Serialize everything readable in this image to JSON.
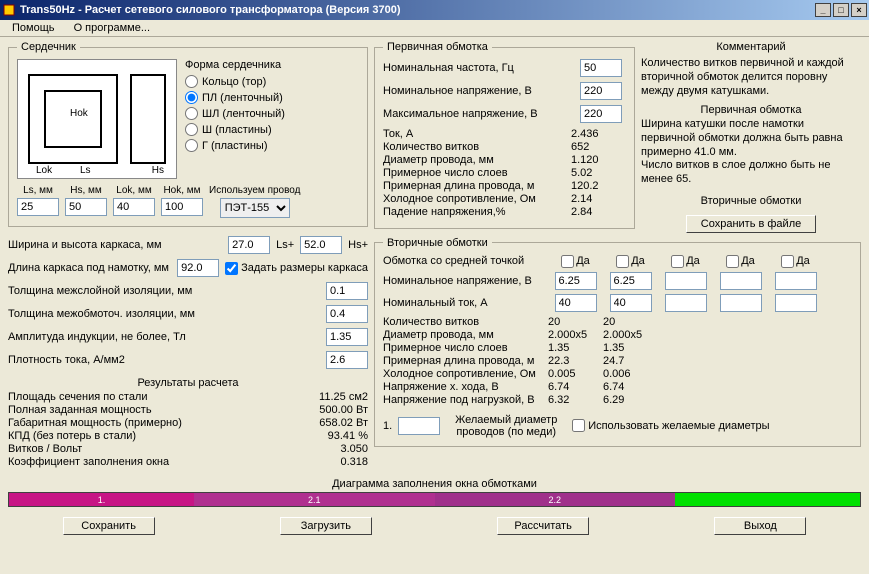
{
  "title": "Trans50Hz - Расчет сетевого силового трансформатора (Версия 3700)",
  "menu": {
    "help": "Помощь",
    "about": "О программе..."
  },
  "core": {
    "legend": "Сердечник",
    "shape_label": "Форма сердечника",
    "opts": {
      "ring": "Кольцо (тор)",
      "pl": "ПЛ (ленточный)",
      "shl": "ШЛ (ленточный)",
      "sh": "Ш (пластины)",
      "g": "Г (пластины)"
    },
    "diagram": {
      "hok": "Hok",
      "lok": "Lok",
      "ls": "Ls",
      "hs": "Hs"
    },
    "dims": {
      "ls_l": "Ls, мм",
      "hs_l": "Hs, мм",
      "lok_l": "Lok, мм",
      "hok_l": "Hok, мм",
      "ls": "25",
      "hs": "50",
      "lok": "40",
      "hok": "100"
    },
    "wire": {
      "label": "Используем провод",
      "sel": "ПЭТ-155"
    },
    "frame_wh": "Ширина и высота каркаса, мм",
    "frame_w": "27.0",
    "frame_ls": "Ls+",
    "frame_h": "52.0",
    "frame_hs": "Hs+",
    "frame_len": "Длина каркаса под намотку, мм",
    "frame_len_v": "92.0",
    "frame_chk": "Задать размеры каркаса",
    "interlayer": "Толщина межслойной изоляции, мм",
    "interlayer_v": "0.1",
    "interwind": "Толщина межобмоточ. изоляции, мм",
    "interwind_v": "0.4",
    "induction": "Амплитуда индукции, не более, Тл",
    "induction_v": "1.35",
    "density": "Плотность тока, А/мм2",
    "density_v": "2.6"
  },
  "results": {
    "title": "Результаты расчета",
    "items": [
      [
        "Площадь сечения по стали",
        "11.25 см2"
      ],
      [
        "Полная заданная мощность",
        "500.00 Вт"
      ],
      [
        "Габаритная мощность (примерно)",
        "658.02 Вт"
      ],
      [
        "КПД (без потерь в стали)",
        "93.41 %"
      ],
      [
        "Витков / Вольт",
        "3.050"
      ],
      [
        "Коэффициент заполнения окна",
        "0.318"
      ]
    ]
  },
  "primary": {
    "legend": "Первичная обмотка",
    "rows": [
      [
        "Номинальная частота, Гц",
        "50"
      ],
      [
        "Номинальное напряжение, В",
        "220"
      ],
      [
        "Максимальное напряжение, В",
        "220"
      ]
    ],
    "out": [
      [
        "Ток, А",
        "2.436"
      ],
      [
        "Количество витков",
        "652"
      ],
      [
        "Диаметр провода, мм",
        "1.120"
      ],
      [
        "Примерное число слоев",
        "5.02"
      ],
      [
        "Примерная длина провода, м",
        "120.2"
      ],
      [
        "Холодное сопротивление, Ом",
        "2.14"
      ],
      [
        "Падение напряжения,%",
        "2.84"
      ]
    ]
  },
  "comments": {
    "title": "Комментарий",
    "p1": "Количество витков первичной и каждой вторичной обмоток делится поровну между двумя катушками.",
    "h2": "Первичная обмотка",
    "p2": "Ширина катушки после намотки первичной обмотки должна быть равна примерно 41.0 мм.",
    "p3": "Число витков в слое должно быть не менее 65.",
    "h3": "Вторичные обмотки",
    "save": "Сохранить в файле"
  },
  "secondary": {
    "legend": "Вторичные обмотки",
    "center": "Обмотка со средней точкой",
    "da": "Да",
    "volt": "Номинальное напряжение, В",
    "v1": "6.25",
    "v2": "6.25",
    "cur": "Номинальный ток, А",
    "c1": "40",
    "c2": "40",
    "out": [
      [
        "Количество витков",
        "20",
        "20"
      ],
      [
        "Диаметр провода, мм",
        "2.000x5",
        "2.000x5"
      ],
      [
        "Примерное число слоев",
        "1.35",
        "1.35"
      ],
      [
        "Примерная длина провода, м",
        "22.3",
        "24.7"
      ],
      [
        "Холодное сопротивление, Ом",
        "0.005",
        "0.006"
      ],
      [
        "Напряжение х. хода, В",
        "6.74",
        "6.74"
      ],
      [
        "Напряжение под нагрузкой, В",
        "6.32",
        "6.29"
      ]
    ],
    "wish_n": "1.",
    "wish_l": "Желаемый диаметр проводов (по меди)",
    "usewish": "Использовать желаемые диаметры"
  },
  "diag": {
    "title": "Диаграмма заполнения окна обмотками",
    "s1": "1.",
    "s2": "2.1",
    "s3": "2.2"
  },
  "buttons": {
    "save": "Сохранить",
    "load": "Загрузить",
    "calc": "Рассчитать",
    "exit": "Выход"
  }
}
